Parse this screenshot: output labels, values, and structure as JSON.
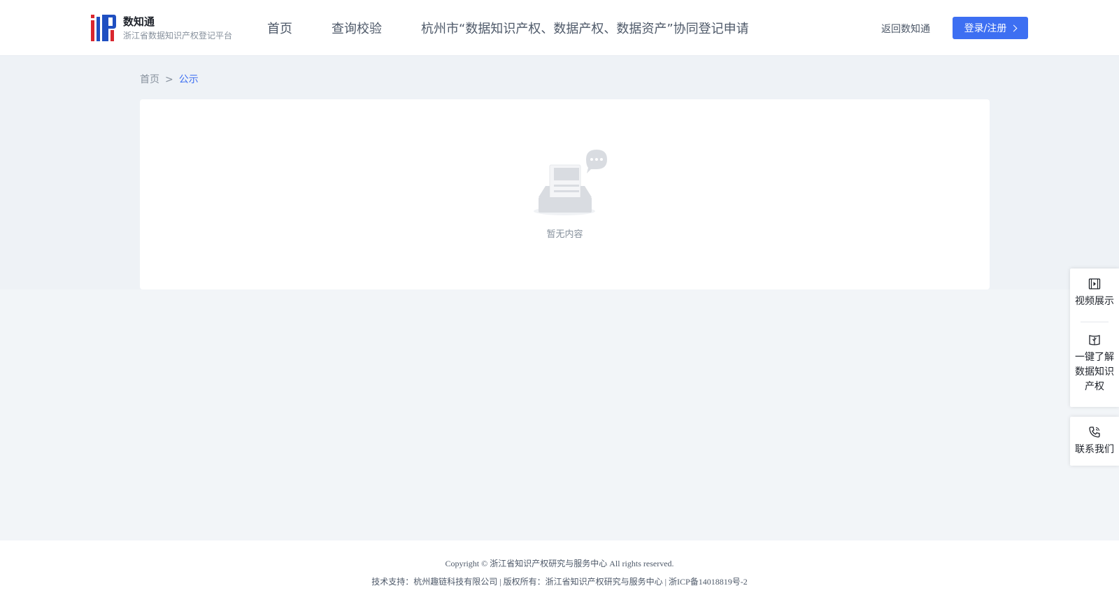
{
  "header": {
    "logo_title": "数知通",
    "logo_subtitle": "浙江省数据知识产权登记平台",
    "nav": [
      {
        "label": "首页"
      },
      {
        "label": "查询校验"
      },
      {
        "label": "杭州市“数据知识产权、数据产权、数据资产”协同登记申请"
      }
    ],
    "back_link": "返回数知通",
    "login_label": "登录/注册"
  },
  "breadcrumb": {
    "home": "首页",
    "separator": ">",
    "current": "公示"
  },
  "main": {
    "empty_text": "暂无内容"
  },
  "side_float": {
    "video": "视频展示",
    "learn": "一键了解数据知识产权",
    "contact": "联系我们"
  },
  "footer": {
    "copyright": "Copyright © 浙江省知识产权研究与服务中心 All rights reserved.",
    "support": "技术支持：杭州趣链科技有限公司 | 版权所有：浙江省知识产权研究与服务中心 | 浙ICP备14018819号-2"
  },
  "colors": {
    "accent": "#3d6ff2",
    "logo_red": "#d9262e",
    "logo_blue": "#1f4fc1"
  }
}
